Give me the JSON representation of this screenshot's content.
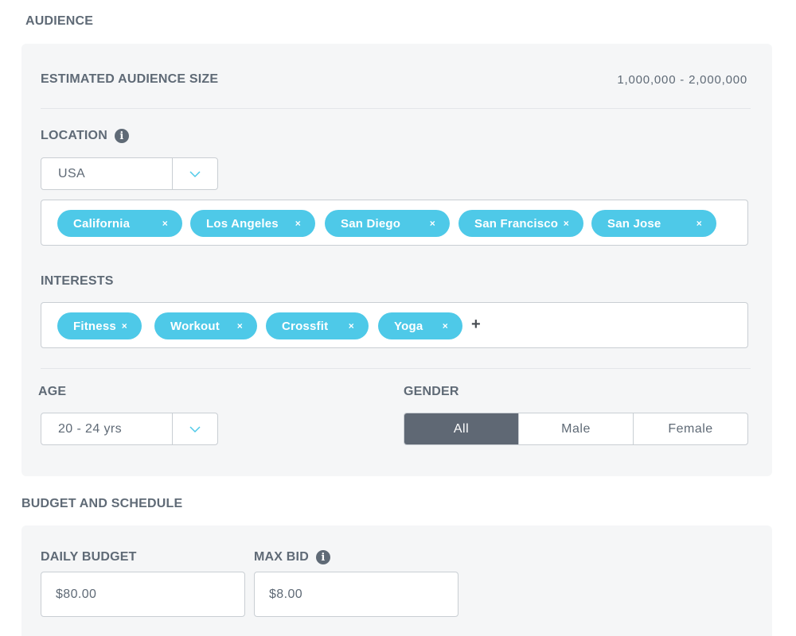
{
  "audience": {
    "title": "AUDIENCE",
    "estimated_size_label": "ESTIMATED AUDIENCE SIZE",
    "estimated_size_value": "1,000,000 - 2,000,000",
    "location": {
      "label": "LOCATION",
      "info_icon": "info-icon",
      "country": "USA",
      "tags": [
        "California",
        "Los Angeles",
        "San Diego",
        "San Francisco",
        "San Jose"
      ],
      "tag_remove_glyph": "×"
    },
    "interests": {
      "label": "INTERESTS",
      "tags": [
        "Fitness",
        "Workout",
        "Crossfit",
        "Yoga"
      ],
      "tag_remove_glyph": "×",
      "add_glyph": "+"
    },
    "age": {
      "label": "AGE",
      "value": "20 - 24 yrs"
    },
    "gender": {
      "label": "GENDER",
      "options": [
        "All",
        "Male",
        "Female"
      ],
      "selected": "All"
    }
  },
  "budget": {
    "title": "BUDGET AND SCHEDULE",
    "daily_budget": {
      "label": "DAILY BUDGET",
      "value": "$80.00"
    },
    "max_bid": {
      "label": "MAX BID",
      "info_icon": "info-icon",
      "value": "$8.00"
    }
  },
  "colors": {
    "accent_tag": "#4ec9e8",
    "chevron": "#4ec9e8",
    "active_segment": "#5f6874",
    "panel_bg": "#f5f6f7",
    "text": "#5f6a76"
  }
}
